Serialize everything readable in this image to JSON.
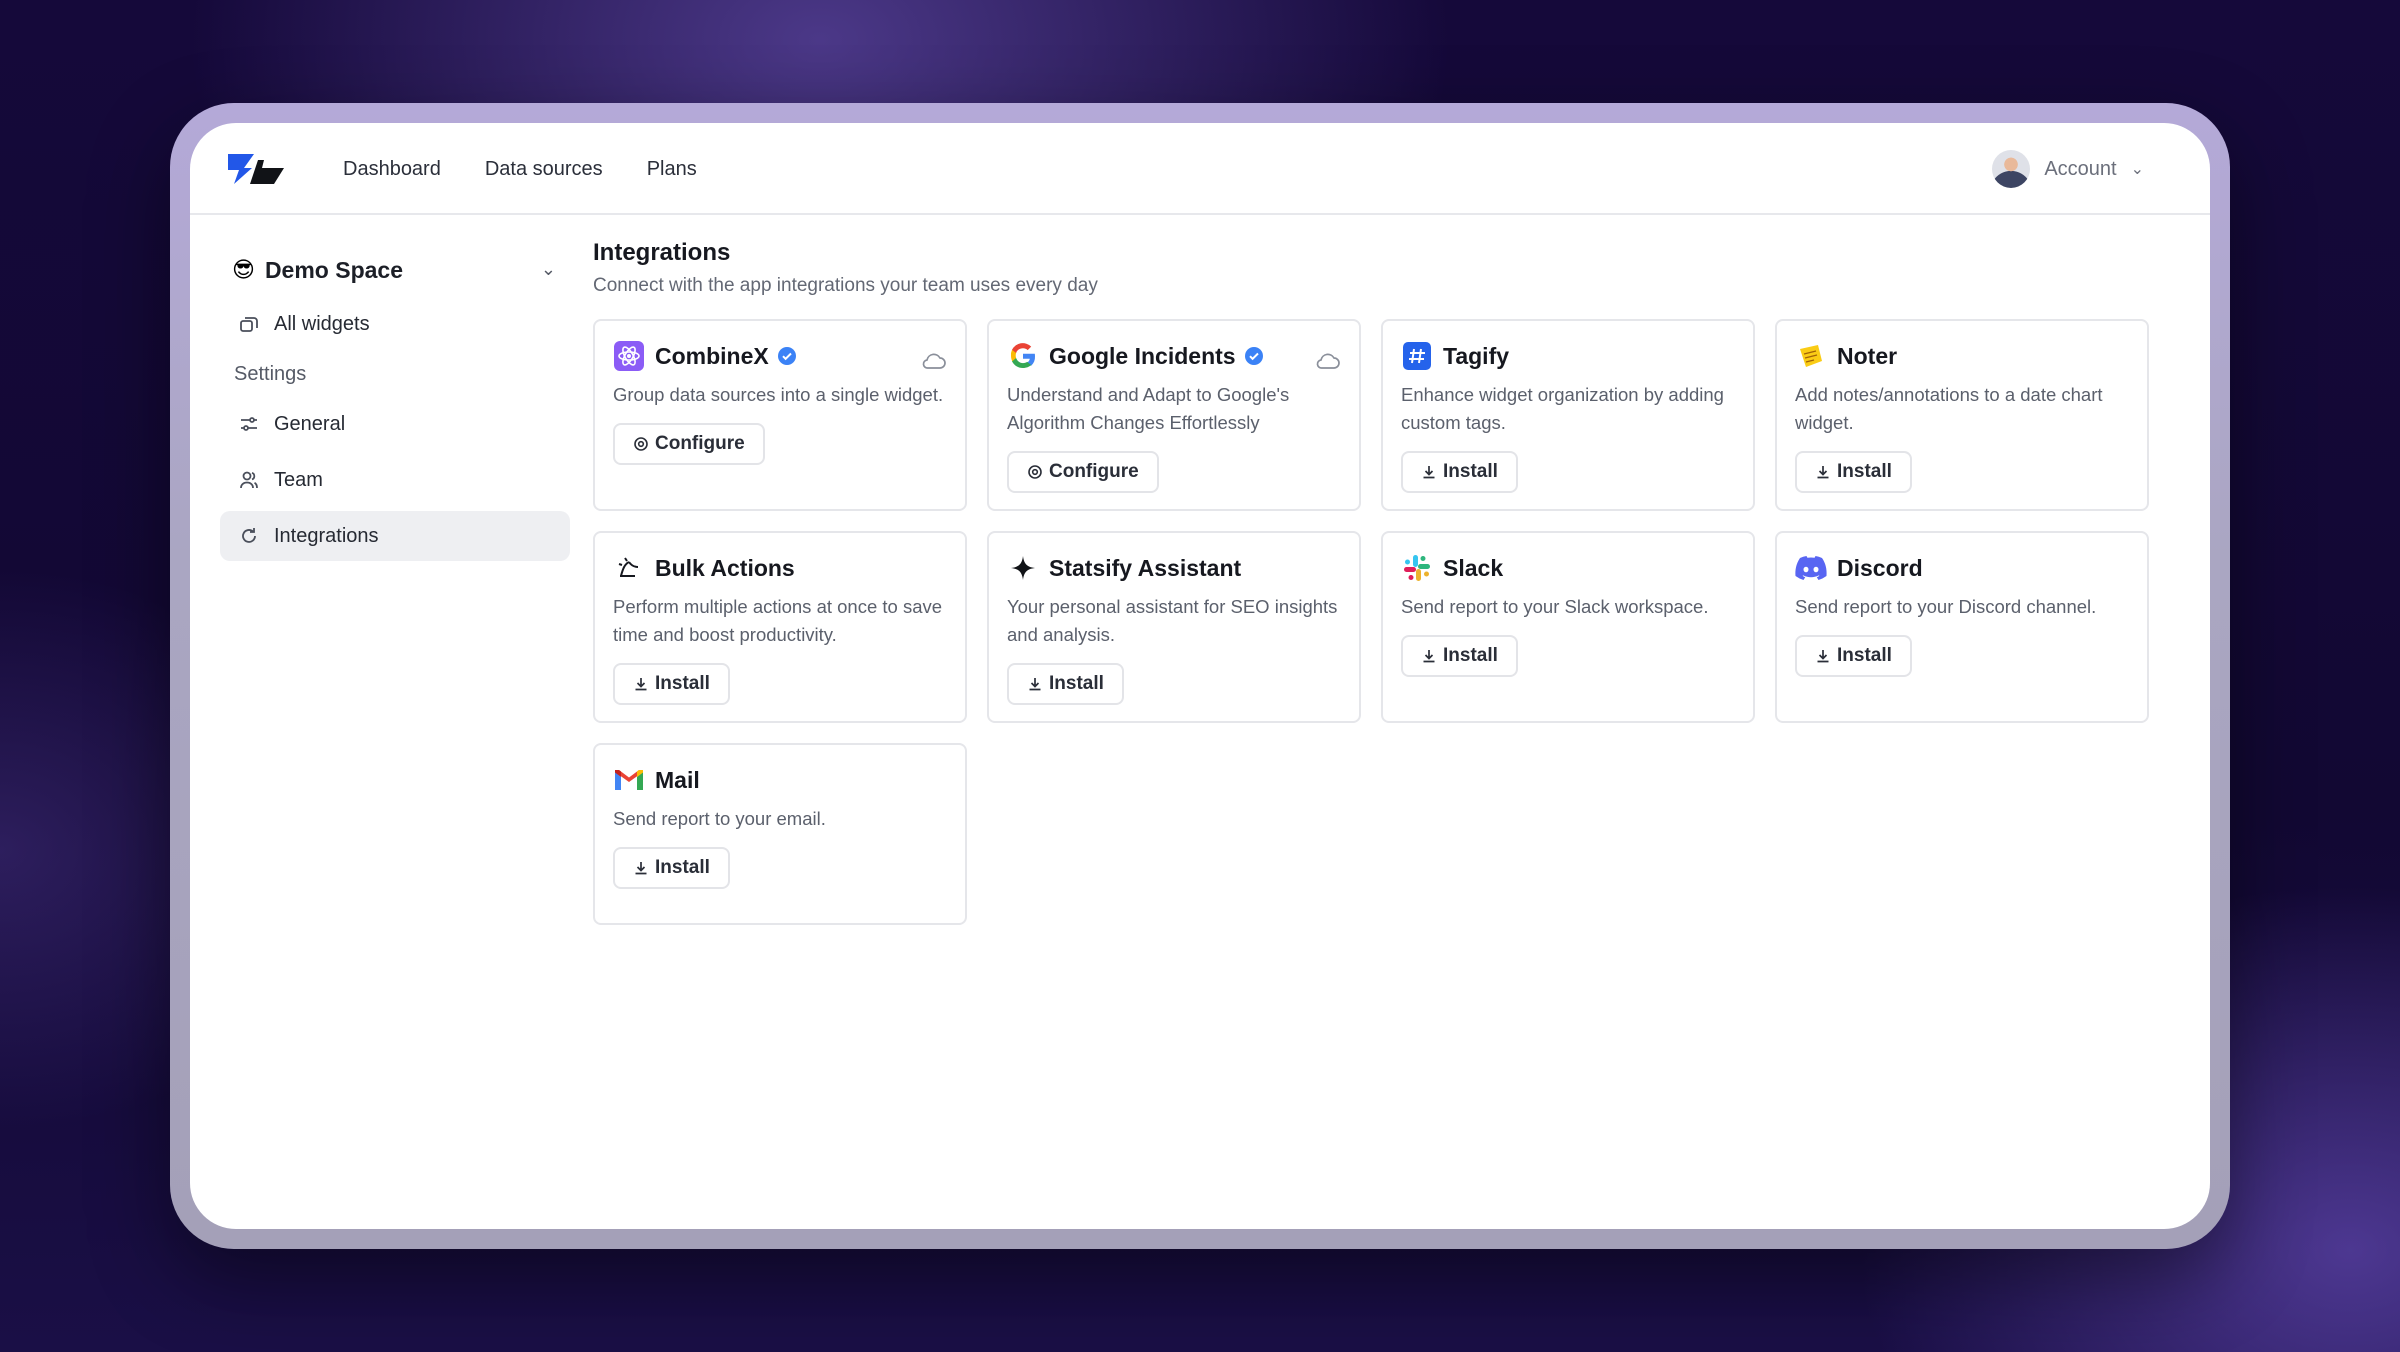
{
  "nav": {
    "links": [
      "Dashboard",
      "Data sources",
      "Plans"
    ],
    "account_label": "Account"
  },
  "sidebar": {
    "space_emoji": "😎",
    "space_name": "Demo Space",
    "all_widgets": "All widgets",
    "settings_label": "Settings",
    "items": [
      {
        "label": "General",
        "icon": "sliders-icon"
      },
      {
        "label": "Team",
        "icon": "users-icon"
      },
      {
        "label": "Integrations",
        "icon": "refresh-icon",
        "active": true
      }
    ]
  },
  "main": {
    "title": "Integrations",
    "subtitle": "Connect with the app integrations your team uses every day"
  },
  "integrations": [
    {
      "name": "CombineX",
      "icon": "atom-icon",
      "verified": true,
      "synced": true,
      "desc": "Group data sources into a single widget.",
      "action": "Configure"
    },
    {
      "name": "Google Incidents",
      "icon": "google-icon",
      "verified": true,
      "synced": true,
      "desc": "Understand and Adapt to Google's Algorithm Changes Effortlessly",
      "action": "Configure"
    },
    {
      "name": "Tagify",
      "icon": "hashtag-icon",
      "verified": false,
      "desc": "Enhance widget organization by adding custom tags.",
      "action": "Install"
    },
    {
      "name": "Noter",
      "icon": "sticky-note-icon",
      "verified": false,
      "desc": "Add notes/annotations to a date chart widget.",
      "action": "Install"
    },
    {
      "name": "Bulk Actions",
      "icon": "bulk-actions-icon",
      "verified": false,
      "desc": "Perform multiple actions at once to save time and boost productivity.",
      "action": "Install"
    },
    {
      "name": "Statsify Assistant",
      "icon": "sparkle-icon",
      "verified": false,
      "desc": "Your personal assistant for SEO insights and analysis.",
      "action": "Install"
    },
    {
      "name": "Slack",
      "icon": "slack-icon",
      "verified": false,
      "desc": "Send report to your Slack workspace.",
      "action": "Install"
    },
    {
      "name": "Discord",
      "icon": "discord-icon",
      "verified": false,
      "desc": "Send report to your Discord channel.",
      "action": "Install"
    },
    {
      "name": "Mail",
      "icon": "gmail-icon",
      "verified": false,
      "desc": "Send report to your email.",
      "action": "Install"
    }
  ],
  "colors": {
    "verified": "#3b82f6",
    "combinex": "#8b5cf6",
    "tagify": "#2563eb",
    "noter": "#facc15",
    "discord": "#5865f2"
  }
}
